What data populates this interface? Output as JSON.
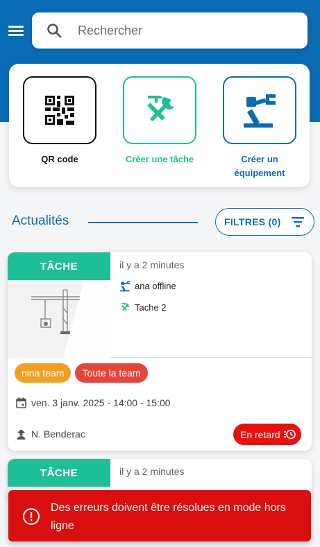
{
  "search": {
    "placeholder": "Rechercher"
  },
  "quick_actions": {
    "qr": {
      "label": "QR code",
      "icon": "qr-code-icon",
      "color": "#111111"
    },
    "task": {
      "label": "Créer une tâche",
      "icon": "tools-icon",
      "color": "#1ebf96"
    },
    "equipment": {
      "label_line1": "Créer un",
      "label_line2": "équipement",
      "icon": "crane-arm-icon",
      "color": "#0a6bb5"
    }
  },
  "news": {
    "title": "Actualités",
    "filters_label": "FILTRES (0)"
  },
  "cards": [
    {
      "type": "TÂCHE",
      "time": "il y a 2 minutes",
      "equipment": "ana offline",
      "task": "Tache 2",
      "tags": [
        "nina team",
        "Toute la team"
      ],
      "date": "ven. 3 janv. 2025 - 14:00 - 15:00",
      "user": "N. Benderac",
      "status": "En retard"
    },
    {
      "type": "TÂCHE",
      "time": "il y a 2 minutes"
    }
  ],
  "toast": {
    "message": "Des erreurs doivent être résolues en mode hors ligne"
  },
  "colors": {
    "primary": "#0a6bb5",
    "accent": "#1ebf96",
    "danger": "#e91010",
    "tag_orange": "#f0a020",
    "tag_red": "#e2453a"
  }
}
